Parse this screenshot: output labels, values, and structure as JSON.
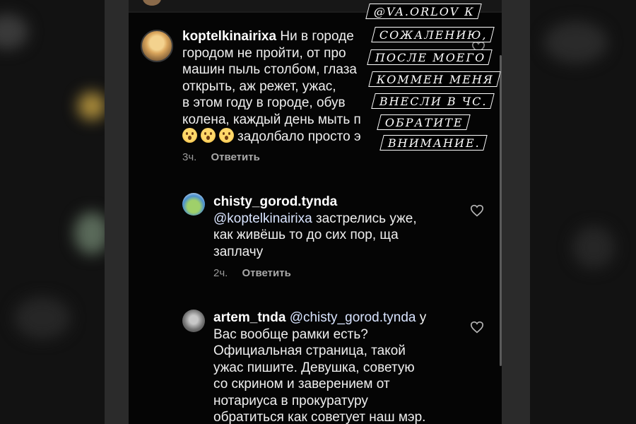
{
  "comments": [
    {
      "username": "koptelkinairixa",
      "lines": [
        "Ни в городе",
        "городом не пройти, от про",
        "машин пыль столбом, глаза",
        "открыть, аж режет, ужас,",
        "в этом году в городе, обув",
        "колена, каждый день мыть п"
      ],
      "emoji_tail": "задолбало просто э",
      "time": "3ч.",
      "reply_label": "Ответить"
    },
    {
      "username": "chisty_gorod.tynda",
      "mention": "@koptelkinairixa",
      "lines_after_mention": " застрелись уже,",
      "lines": [
        "как живёшь то до сих пор, ща",
        "заплачу"
      ],
      "time": "2ч.",
      "reply_label": "Ответить"
    },
    {
      "username": "artem_tnda",
      "mention": "@chisty_gorod.tynda",
      "after_mention": " у",
      "lines": [
        "Вас вообще рамки есть?",
        "Официальная страница, такой",
        "ужас пишите. Девушка, советую",
        "со скрином и заверением от",
        "нотариуса в прокуратуру",
        "обратиться как советует наш мэр."
      ]
    }
  ],
  "sticker": [
    "@VA.ORLOV К",
    "СОЖАЛЕНИЮ,",
    "ПОСЛЕ МОЕГО",
    "КОММЕН МЕНЯ",
    "ВНЕСЛИ В ЧС.",
    "ОБРАТИТЕ",
    "ВНИМАНИЕ."
  ],
  "colors": {
    "background": "#050505",
    "text": "#efefef",
    "meta": "#9a9a9a",
    "sticker_bg": "#000000",
    "sticker_border": "#ffffff"
  },
  "icons": [
    "heart-icon",
    "emoji-icon"
  ]
}
